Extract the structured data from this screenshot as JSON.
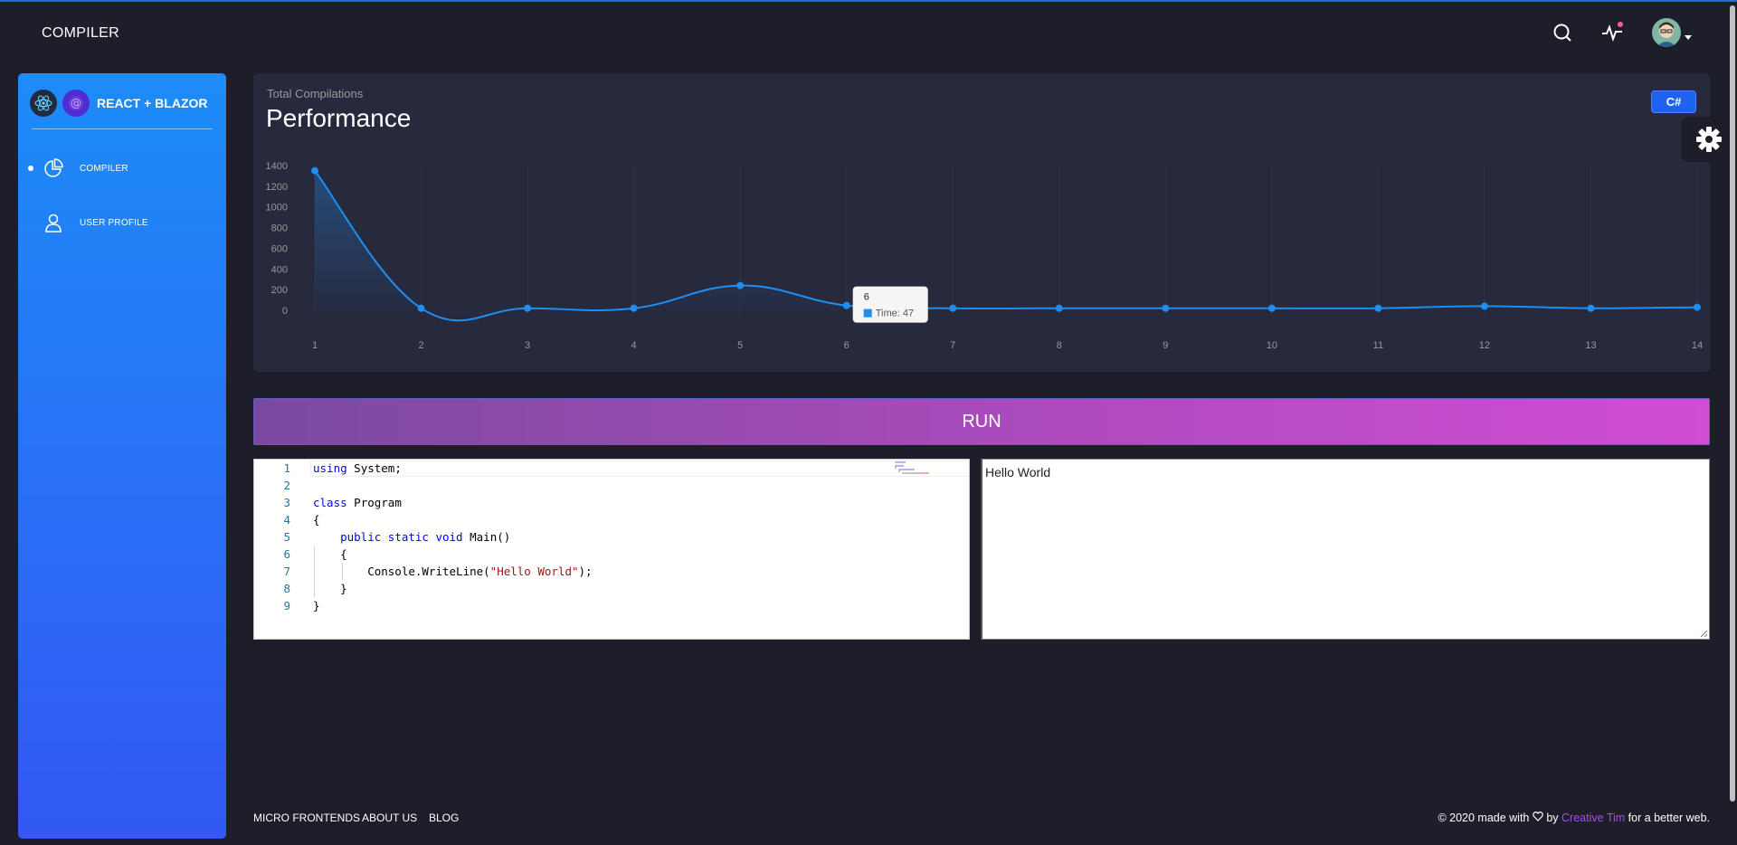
{
  "header": {
    "brand": "COMPILER"
  },
  "sidebar": {
    "logo_text": "REACT + BLAZOR",
    "items": [
      {
        "label": "COMPILER",
        "icon": "chart-pie-icon",
        "active": true
      },
      {
        "label": "USER PROFILE",
        "icon": "user-icon",
        "active": false
      }
    ]
  },
  "card": {
    "subtitle": "Total Compilations",
    "title": "Performance",
    "language_button": "C#"
  },
  "chart_data": {
    "type": "line",
    "categories": [
      "1",
      "2",
      "3",
      "4",
      "5",
      "6",
      "7",
      "8",
      "9",
      "10",
      "11",
      "12",
      "13",
      "14"
    ],
    "series": [
      {
        "name": "Time",
        "values": [
          1350,
          20,
          20,
          20,
          240,
          47,
          20,
          20,
          20,
          20,
          20,
          40,
          20,
          30
        ]
      }
    ],
    "yticks": [
      "1400",
      "1200",
      "1000",
      "800",
      "600",
      "400",
      "200",
      "0"
    ],
    "ylim": [
      0,
      1400
    ],
    "tooltip": {
      "title": "6",
      "label": "Time: 47"
    },
    "accent": "#1f8ef1",
    "grid": "vertical"
  },
  "run_button": {
    "label": "RUN"
  },
  "editor": {
    "lines": [
      {
        "num": "1",
        "tokens": [
          {
            "t": "using",
            "c": "kw"
          },
          {
            "t": " System;",
            "c": ""
          }
        ]
      },
      {
        "num": "2",
        "tokens": []
      },
      {
        "num": "3",
        "tokens": [
          {
            "t": "class",
            "c": "kw"
          },
          {
            "t": " Program",
            "c": ""
          }
        ]
      },
      {
        "num": "4",
        "tokens": [
          {
            "t": "{",
            "c": ""
          }
        ]
      },
      {
        "num": "5",
        "tokens": [
          {
            "t": "    ",
            "c": ""
          },
          {
            "t": "public",
            "c": "kw"
          },
          {
            "t": " ",
            "c": ""
          },
          {
            "t": "static",
            "c": "kw"
          },
          {
            "t": " ",
            "c": ""
          },
          {
            "t": "void",
            "c": "kw"
          },
          {
            "t": " Main()",
            "c": ""
          }
        ]
      },
      {
        "num": "6",
        "tokens": [
          {
            "t": "    {",
            "c": ""
          }
        ]
      },
      {
        "num": "7",
        "tokens": [
          {
            "t": "        Console.WriteLine(",
            "c": ""
          },
          {
            "t": "\"Hello World\"",
            "c": "str"
          },
          {
            "t": ");",
            "c": ""
          }
        ]
      },
      {
        "num": "8",
        "tokens": [
          {
            "t": "    }",
            "c": ""
          }
        ]
      },
      {
        "num": "9",
        "tokens": [
          {
            "t": "}",
            "c": ""
          }
        ]
      }
    ]
  },
  "output": {
    "text": "Hello World"
  },
  "footer": {
    "links": [
      "MICRO FRONTENDS",
      "ABOUT US",
      "BLOG"
    ],
    "copyright_prefix": "© 2020 made with",
    "copyright_by": "by",
    "copyright_author": "Creative Tim",
    "copyright_suffix": "for a better web."
  }
}
